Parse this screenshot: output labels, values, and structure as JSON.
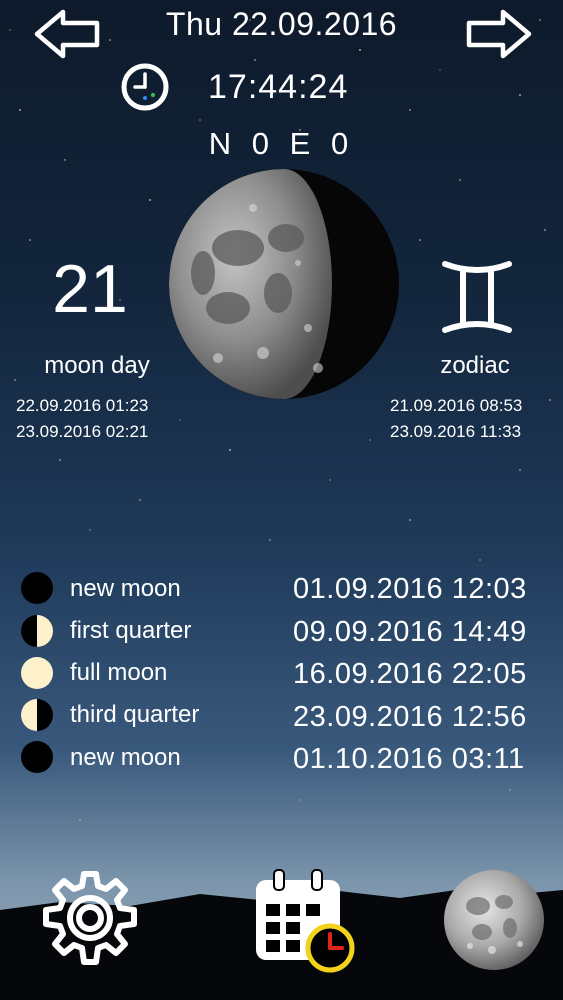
{
  "header": {
    "date": "Thu 22.09.2016",
    "time": "17:44:24",
    "coordinates": "N 0 E 0"
  },
  "moon_day": {
    "number": "21",
    "label": "moon day",
    "start": "22.09.2016 01:23",
    "end": "23.09.2016 02:21"
  },
  "zodiac": {
    "label": "zodiac",
    "sign_icon": "gemini-icon",
    "start": "21.09.2016 08:53",
    "end": "23.09.2016 11:33"
  },
  "phases": [
    {
      "name": "new moon",
      "date": "01.09.2016 12:03",
      "icon": "new-moon-icon"
    },
    {
      "name": "first quarter",
      "date": "09.09.2016 14:49",
      "icon": "first-quarter-icon"
    },
    {
      "name": "full moon",
      "date": "16.09.2016 22:05",
      "icon": "full-moon-icon"
    },
    {
      "name": "third quarter",
      "date": "23.09.2016 12:56",
      "icon": "third-quarter-icon"
    },
    {
      "name": "new moon",
      "date": "01.10.2016 03:11",
      "icon": "new-moon-icon"
    }
  ],
  "colors": {
    "moon_lit": "#fdf1cc",
    "clock_accent": "#f2d21a"
  },
  "bottom_bar": {
    "icons": [
      "gear-icon",
      "calendar-clock-icon",
      "moon-icon"
    ]
  }
}
